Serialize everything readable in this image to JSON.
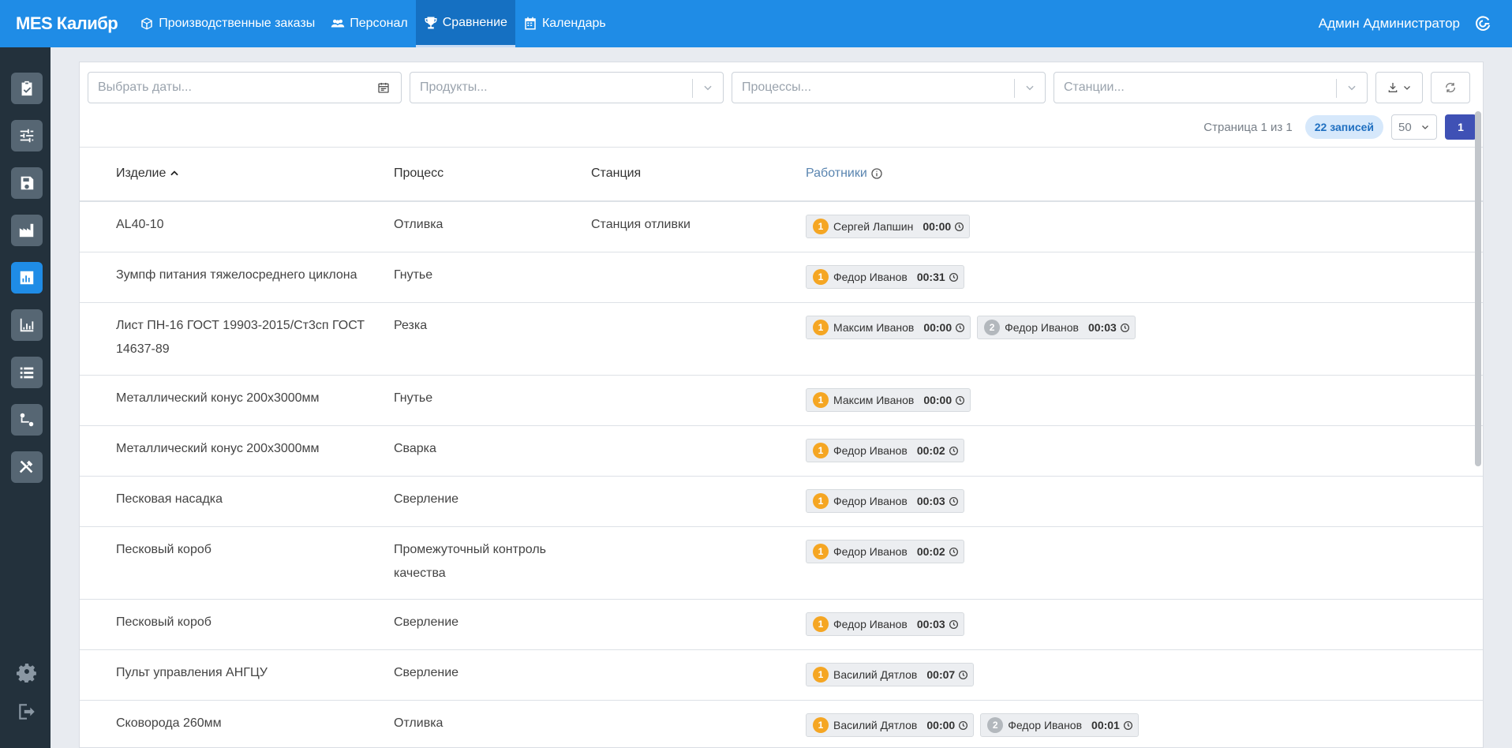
{
  "brand": "MES Калибр",
  "nav": [
    {
      "label": "Производственные заказы",
      "icon": "box-icon"
    },
    {
      "label": "Персонал",
      "icon": "users-icon"
    },
    {
      "label": "Сравнение",
      "icon": "trophy-icon",
      "active": true
    },
    {
      "label": "Календарь",
      "icon": "calendar-icon"
    }
  ],
  "user": {
    "name": "Админ Администратор"
  },
  "filters": {
    "dates_placeholder": "Выбрать даты...",
    "products_placeholder": "Продукты...",
    "processes_placeholder": "Процессы...",
    "stations_placeholder": "Станции..."
  },
  "pager": {
    "info": "Страница 1 из 1",
    "count": "22 записей",
    "page_size": "50",
    "current_page": "1"
  },
  "columns": {
    "product": "Изделие",
    "process": "Процесс",
    "station": "Станция",
    "workers": "Работники"
  },
  "rows": [
    {
      "product": "AL40-10",
      "process": "Отливка",
      "station": "Станция отливки",
      "workers": [
        {
          "rank": "1",
          "name": "Сергей Лапшин",
          "time": "00:00"
        }
      ]
    },
    {
      "product": "Зумпф питания тяжелосреднего циклона",
      "process": "Гнутье",
      "station": "",
      "workers": [
        {
          "rank": "1",
          "name": "Федор Иванов",
          "time": "00:31"
        }
      ]
    },
    {
      "product": "Лист ПН-16 ГОСТ 19903-2015/Ст3сп ГОСТ 14637-89",
      "process": "Резка",
      "station": "",
      "workers": [
        {
          "rank": "1",
          "name": "Максим Иванов",
          "time": "00:00"
        },
        {
          "rank": "2",
          "name": "Федор Иванов",
          "time": "00:03"
        }
      ]
    },
    {
      "product": "Металлический конус 200х3000мм",
      "process": "Гнутье",
      "station": "",
      "workers": [
        {
          "rank": "1",
          "name": "Максим Иванов",
          "time": "00:00"
        }
      ]
    },
    {
      "product": "Металлический конус 200х3000мм",
      "process": "Сварка",
      "station": "",
      "workers": [
        {
          "rank": "1",
          "name": "Федор Иванов",
          "time": "00:02"
        }
      ]
    },
    {
      "product": "Песковая насадка",
      "process": "Сверление",
      "station": "",
      "workers": [
        {
          "rank": "1",
          "name": "Федор Иванов",
          "time": "00:03"
        }
      ]
    },
    {
      "product": "Песковый короб",
      "process": "Промежуточный контроль качества",
      "station": "",
      "workers": [
        {
          "rank": "1",
          "name": "Федор Иванов",
          "time": "00:02"
        }
      ]
    },
    {
      "product": "Песковый короб",
      "process": "Сверление",
      "station": "",
      "workers": [
        {
          "rank": "1",
          "name": "Федор Иванов",
          "time": "00:03"
        }
      ]
    },
    {
      "product": "Пульт управления АНГЦУ",
      "process": "Сверление",
      "station": "",
      "workers": [
        {
          "rank": "1",
          "name": "Василий Дятлов",
          "time": "00:07"
        }
      ]
    },
    {
      "product": "Сковорода 260мм",
      "process": "Отливка",
      "station": "",
      "workers": [
        {
          "rank": "1",
          "name": "Василий Дятлов",
          "time": "00:00"
        },
        {
          "rank": "2",
          "name": "Федор Иванов",
          "time": "00:01"
        }
      ]
    }
  ]
}
